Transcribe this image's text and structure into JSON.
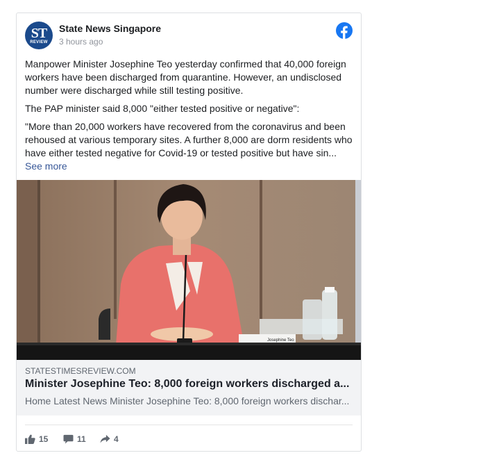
{
  "post": {
    "page_name": "State News Singapore",
    "timestamp": "3 hours ago",
    "avatar": {
      "line1": "ST",
      "line2": "REVIEW"
    },
    "paragraphs": [
      "Manpower Minister Josephine Teo yesterday confirmed that 40,000 foreign workers have been discharged from quarantine. However, an undisclosed number were discharged while still testing positive.",
      "The PAP minister said 8,000 \"either tested positive or negative\":",
      "\"More than 20,000 workers have recovered from the coronavirus and been rehoused at various temporary sites. A further 8,000 are dorm residents who have either tested negative for Covid-19 or tested positive but have sin..."
    ],
    "see_more": "See more",
    "nameplate": "Josephine Teo"
  },
  "link_preview": {
    "domain": "STATESTIMESREVIEW.COM",
    "title": "Minister Josephine Teo: 8,000 foreign workers discharged a...",
    "description": "Home Latest News Minister Josephine Teo: 8,000 foreign workers dischar..."
  },
  "reactions": {
    "likes": "15",
    "comments": "11",
    "shares": "4"
  },
  "colors": {
    "facebook_blue": "#1877f2",
    "link": "#385898",
    "avatar_bg": "#1b4a8c",
    "blazer": "#e8716b"
  },
  "icons": [
    "facebook-icon",
    "like-icon",
    "comment-icon",
    "share-icon"
  ]
}
